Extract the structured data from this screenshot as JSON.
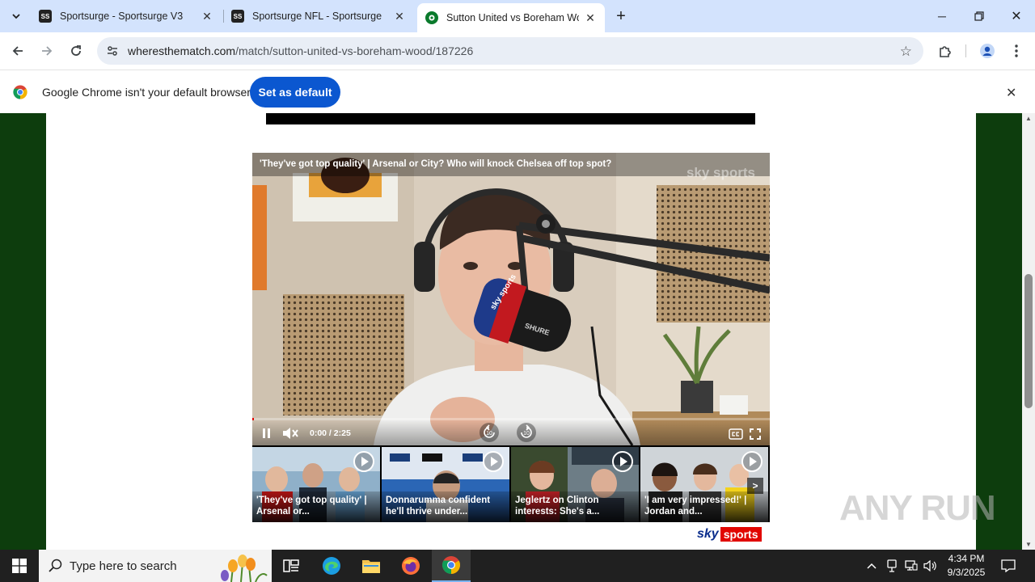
{
  "browser": {
    "tabs": [
      {
        "favicon": "SS",
        "title": "Sportsurge - Sportsurge V3",
        "active": false
      },
      {
        "favicon": "SS",
        "title": "Sportsurge NFL - Sportsurge",
        "active": false
      },
      {
        "favicon": "ball",
        "title": "Sutton United vs Boreham Woo",
        "active": true
      }
    ],
    "url_domain": "wheresthematch.com",
    "url_path": "/match/sutton-united-vs-boreham-wood/187226"
  },
  "infobar": {
    "message": "Google Chrome isn't your default browser",
    "button_label": "Set as default"
  },
  "video": {
    "title": "'They've got top quality' | Arsenal or City? Who will knock Chelsea off top spot?",
    "watermark": "sky sports",
    "time": "0:00 / 2:25",
    "progress_fraction": 0.0,
    "mic_brand": "SHURE",
    "mic_flag": "sky sports",
    "skip_back": "10",
    "skip_forward": "10"
  },
  "thumbnails": [
    {
      "line1": "'They've got top quality' |",
      "line2": "Arsenal or..."
    },
    {
      "line1": "Donnarumma confident",
      "line2": "he'll thrive under..."
    },
    {
      "line1": "Jeglertz on Clinton",
      "line2": "interests: She's a..."
    },
    {
      "line1": "'I am very impressed!' |",
      "line2": "Jordan and..."
    }
  ],
  "thumb_next": ">",
  "branding": {
    "sky": "sky",
    "sports": "sports"
  },
  "overlay_watermark": "ANY RUN",
  "taskbar": {
    "search_placeholder": "Type here to search",
    "time": "4:34 PM",
    "date": "9/3/2025"
  },
  "colors": {
    "tabstrip": "#d3e3fd",
    "accent": "#0b57d0",
    "page_bg": "#0d3d0d",
    "sky_red": "#e10600",
    "taskbar": "#202020"
  }
}
